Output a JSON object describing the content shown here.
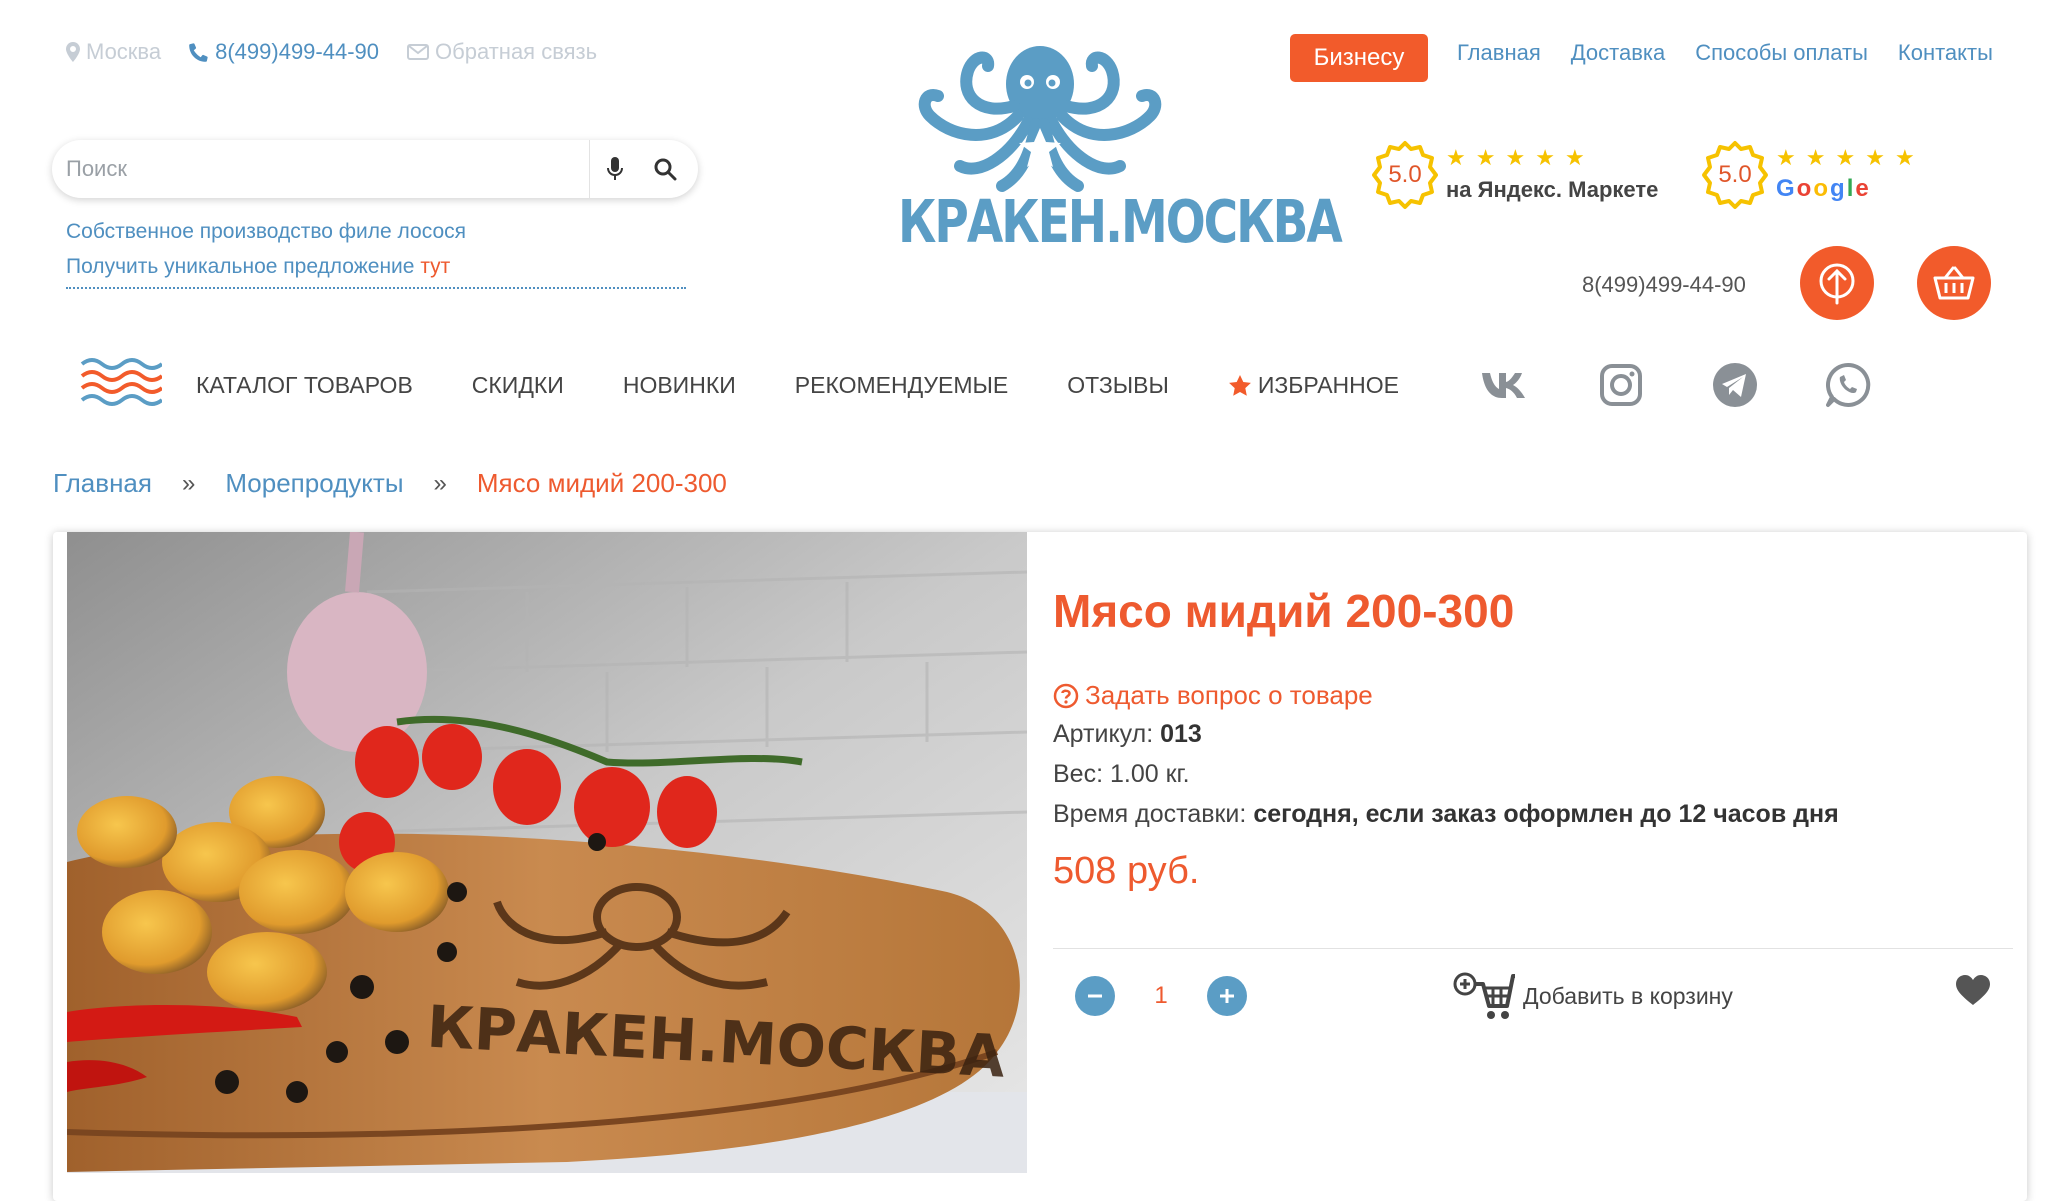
{
  "header": {
    "city": "Москва",
    "phone": "8(499)499-44-90",
    "feedback": "Обратная связь",
    "search_placeholder": "Поиск",
    "promo_line1": "Собственное производство филе лосося",
    "promo_line2_prefix": "Получить уникальное предложение",
    "promo_line2_accent": "тут",
    "logo_text": "КРАКЕН.МОСКВА",
    "business_label": "Бизнесу",
    "topnav": [
      "Главная",
      "Доставка",
      "Способы оплаты",
      "Контакты"
    ],
    "rating_yandex": {
      "value": "5.0",
      "source": "на Яндекс. Маркете",
      "stars": 5
    },
    "rating_google": {
      "value": "5.0",
      "source": "Google",
      "stars": 5
    },
    "phone_right": "8(499)499-44-90"
  },
  "nav": {
    "items": [
      "КАТАЛОГ ТОВАРОВ",
      "СКИДКИ",
      "НОВИНКИ",
      "РЕКОМЕНДУЕМЫЕ",
      "ОТЗЫВЫ"
    ],
    "favorites": "ИЗБРАННОЕ",
    "socials": [
      "vk-icon",
      "instagram-icon",
      "telegram-icon",
      "whatsapp-icon"
    ]
  },
  "breadcrumb": {
    "home": "Главная",
    "category": "Морепродукты",
    "current": "Мясо мидий 200-300",
    "separator": "»"
  },
  "product": {
    "title": "Мясо мидий 200-300",
    "ask_label": "Задать вопрос о товаре",
    "sku_label": "Артикул:",
    "sku_value": "013",
    "weight_label": "Вес:",
    "weight_value": "1.00 кг.",
    "delivery_label": "Время доставки:",
    "delivery_value": "сегодня, если заказ оформлен до 12 часов дня",
    "price": "508 руб.",
    "quantity": "1",
    "add_to_cart": "Добавить в корзину",
    "board_text": "КРАКЕН.МОСКВА"
  },
  "colors": {
    "accent": "#f25b2b",
    "link": "#4f8fc0",
    "brand_blue": "#5b9dc5",
    "star": "#f6c200"
  }
}
